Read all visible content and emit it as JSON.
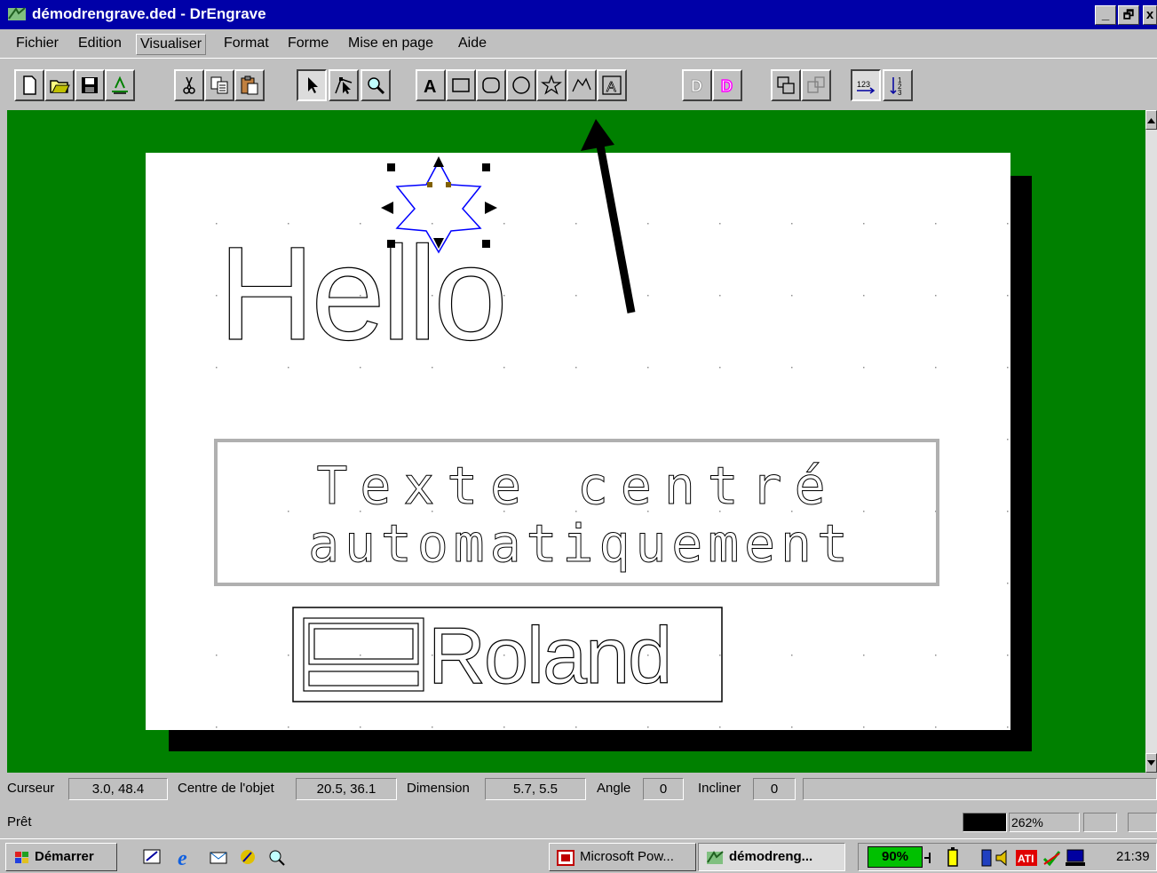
{
  "window": {
    "title": "démodrengrave.ded - DrEngrave",
    "minimize_glyph": "_",
    "maximize_glyph": "🗗",
    "close_glyph": "x"
  },
  "menu": {
    "items": [
      "Fichier",
      "Edition",
      "Visualiser",
      "Format",
      "Forme",
      "Mise en page",
      "Aide"
    ],
    "active": "Visualiser"
  },
  "toolbar": {
    "buttons": [
      "new-document-icon",
      "open-folder-icon",
      "save-icon",
      "import-icon",
      "cut-icon",
      "copy-icon",
      "paste-icon",
      "select-arrow-icon",
      "node-edit-icon",
      "zoom-icon",
      "text-tool-icon",
      "rectangle-tool-icon",
      "rounded-rectangle-tool-icon",
      "ellipse-tool-icon",
      "star-tool-icon",
      "polyline-tool-icon",
      "framed-text-tool-icon",
      "outline-d-icon",
      "filled-d-icon",
      "group-icon",
      "ungroup-icon",
      "numbering-icon",
      "fraction-numbering-icon"
    ],
    "star_tool_selected": true
  },
  "canvas": {
    "hello_text": "Hello",
    "centered_text_line1": "Texte centré",
    "centered_text_line2": "automatiquement",
    "logo_text": "Roland",
    "selected_shape": "star",
    "page_color": "#ffffff",
    "workspace_color": "#008000"
  },
  "info": {
    "cursor_label": "Curseur",
    "cursor_value": "3.0, 48.4",
    "center_label": "Centre de l'objet",
    "center_value": "20.5, 36.1",
    "dimension_label": "Dimension",
    "dimension_value": "5.7, 5.5",
    "angle_label": "Angle",
    "angle_value": "0",
    "incline_label": "Incliner",
    "incline_value": "0"
  },
  "status": {
    "text": "Prêt",
    "zoom": "262%"
  },
  "taskbar": {
    "start_label": "Démarrer",
    "tasks": [
      "Microsoft Pow...",
      "démodreng..."
    ],
    "battery": "90%",
    "clock": "21:39"
  }
}
